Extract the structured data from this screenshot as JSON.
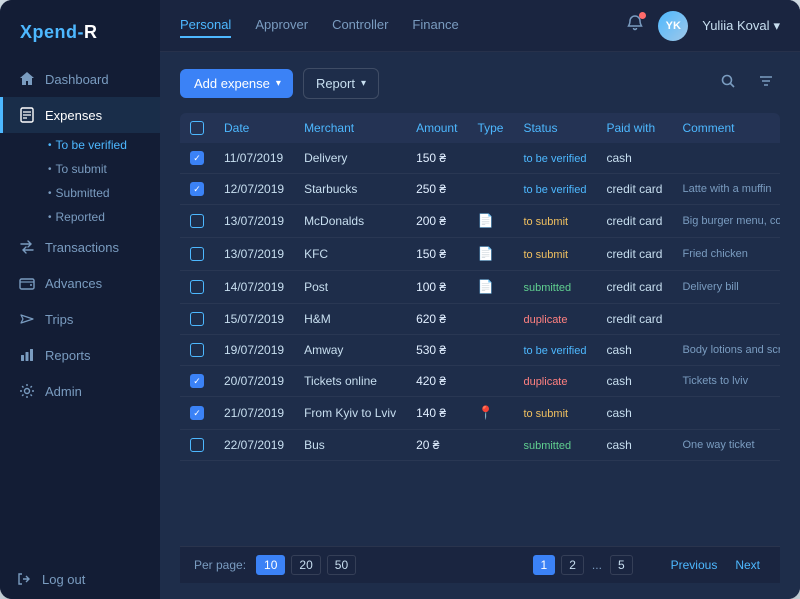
{
  "app": {
    "logo_prefix": "Xpend-",
    "logo_suffix": "R"
  },
  "sidebar": {
    "items": [
      {
        "id": "dashboard",
        "label": "Dashboard",
        "icon": "home"
      },
      {
        "id": "expenses",
        "label": "Expenses",
        "icon": "receipt",
        "active": true
      },
      {
        "id": "transactions",
        "label": "Transactions",
        "icon": "arrows"
      },
      {
        "id": "advances",
        "label": "Advances",
        "icon": "wallet"
      },
      {
        "id": "trips",
        "label": "Trips",
        "icon": "plane"
      },
      {
        "id": "reports",
        "label": "Reports",
        "icon": "chart"
      },
      {
        "id": "admin",
        "label": "Admin",
        "icon": "gear"
      }
    ],
    "sub_items": [
      {
        "id": "to-be-verified",
        "label": "To be verified",
        "active": true
      },
      {
        "id": "to-submit",
        "label": "To submit"
      },
      {
        "id": "submitted",
        "label": "Submitted"
      },
      {
        "id": "reported",
        "label": "Reported"
      }
    ],
    "logout_label": "Log out"
  },
  "topbar": {
    "tabs": [
      {
        "id": "personal",
        "label": "Personal",
        "active": true
      },
      {
        "id": "approver",
        "label": "Approver"
      },
      {
        "id": "controller",
        "label": "Controller"
      },
      {
        "id": "finance",
        "label": "Finance"
      }
    ],
    "user_name": "Yuliia Koval",
    "user_initials": "YK"
  },
  "toolbar": {
    "add_expense_label": "Add expense",
    "report_label": "Report"
  },
  "table": {
    "headers": [
      "",
      "Date",
      "Merchant",
      "Amount",
      "Type",
      "Status",
      "Paid with",
      "Comment"
    ],
    "rows": [
      {
        "checked": true,
        "date": "11/07/2019",
        "merchant": "Delivery",
        "amount": "150 ₴",
        "type": "",
        "status": "to be verified",
        "paid_with": "cash",
        "comment": "",
        "status_class": "status-verify",
        "doc": false,
        "doc_green": false
      },
      {
        "checked": true,
        "date": "12/07/2019",
        "merchant": "Starbucks",
        "amount": "250 ₴",
        "type": "",
        "status": "to be verified",
        "paid_with": "credit card",
        "comment": "Latte with a muffin",
        "status_class": "status-verify",
        "doc": false,
        "doc_green": false
      },
      {
        "checked": false,
        "date": "13/07/2019",
        "merchant": "McDonalds",
        "amount": "200 ₴",
        "type": "doc",
        "status": "to submit",
        "paid_with": "credit card",
        "comment": "Big burger menu, cola light",
        "status_class": "status-submit",
        "doc": true,
        "doc_green": false
      },
      {
        "checked": false,
        "date": "13/07/2019",
        "merchant": "KFC",
        "amount": "150 ₴",
        "type": "doc",
        "status": "to submit",
        "paid_with": "credit card",
        "comment": "Fried chicken",
        "status_class": "status-submit",
        "doc": true,
        "doc_green": false
      },
      {
        "checked": false,
        "date": "14/07/2019",
        "merchant": "Post",
        "amount": "100 ₴",
        "type": "doc",
        "status": "submitted",
        "paid_with": "credit card",
        "comment": "Delivery bill",
        "status_class": "status-submitted",
        "doc": true,
        "doc_green": false
      },
      {
        "checked": false,
        "date": "15/07/2019",
        "merchant": "H&M",
        "amount": "620 ₴",
        "type": "",
        "status": "duplicate",
        "paid_with": "credit card",
        "comment": "",
        "status_class": "status-duplicate",
        "doc": false,
        "doc_green": false
      },
      {
        "checked": false,
        "date": "19/07/2019",
        "merchant": "Amway",
        "amount": "530 ₴",
        "type": "",
        "status": "to be verified",
        "paid_with": "cash",
        "comment": "Body lotions and scrub",
        "status_class": "status-verify",
        "doc": false,
        "doc_green": false
      },
      {
        "checked": true,
        "date": "20/07/2019",
        "merchant": "Tickets online",
        "amount": "420 ₴",
        "type": "",
        "status": "duplicate",
        "paid_with": "cash",
        "comment": "Tickets to lviv",
        "status_class": "status-duplicate",
        "doc": false,
        "doc_green": false
      },
      {
        "checked": true,
        "date": "21/07/2019",
        "merchant": "From Kyiv to Lviv",
        "amount": "140 ₴",
        "type": "doc_green",
        "status": "to submit",
        "paid_with": "cash",
        "comment": "",
        "status_class": "status-submit",
        "doc": false,
        "doc_green": true
      },
      {
        "checked": false,
        "date": "22/07/2019",
        "merchant": "Bus",
        "amount": "20 ₴",
        "type": "",
        "status": "submitted",
        "paid_with": "cash",
        "comment": "One way ticket",
        "status_class": "status-submitted",
        "doc": false,
        "doc_green": false
      }
    ]
  },
  "pagination": {
    "per_page_label": "Per page:",
    "per_page_options": [
      "10",
      "20",
      "50"
    ],
    "per_page_active": "10",
    "pages": [
      "1",
      "2",
      "...",
      "5"
    ],
    "active_page": "1",
    "prev_label": "Previous",
    "next_label": "Next"
  }
}
